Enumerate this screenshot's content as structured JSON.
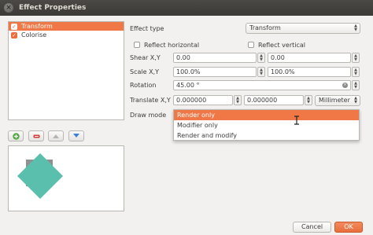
{
  "window": {
    "title": "Effect Properties",
    "close_glyph": "×"
  },
  "effect_list": {
    "items": [
      {
        "label": "Transform",
        "checked": true,
        "selected": true
      },
      {
        "label": "Colorise",
        "checked": true,
        "selected": false
      }
    ]
  },
  "list_toolbar": {
    "buttons": [
      "add-effect-icon",
      "remove-effect-icon",
      "move-up-icon",
      "move-down-icon"
    ]
  },
  "form": {
    "effect_type_label": "Effect type",
    "effect_type_value": "Transform",
    "reflect_horizontal_label": "Reflect horizontal",
    "reflect_vertical_label": "Reflect vertical",
    "shear_label": "Shear X,Y",
    "shear_x": "0.00",
    "shear_y": "0.00",
    "scale_label": "Scale X,Y",
    "scale_x": "100.0%",
    "scale_y": "100.0%",
    "rotation_label": "Rotation",
    "rotation_value": "45.00 °",
    "translate_label": "Translate X,Y",
    "translate_x": "0.000000",
    "translate_y": "0.000000",
    "translate_unit": "Millimeter",
    "draw_mode_label": "Draw mode"
  },
  "draw_mode_dropdown": {
    "options": [
      "Render only",
      "Modifier only",
      "Render and modify"
    ],
    "highlighted_index": 0
  },
  "dialog_buttons": {
    "cancel": "Cancel",
    "ok": "OK"
  },
  "colors": {
    "accent": "#f07746",
    "preview_shape_fill": "#5bbfae",
    "preview_shadow": "#909090"
  }
}
